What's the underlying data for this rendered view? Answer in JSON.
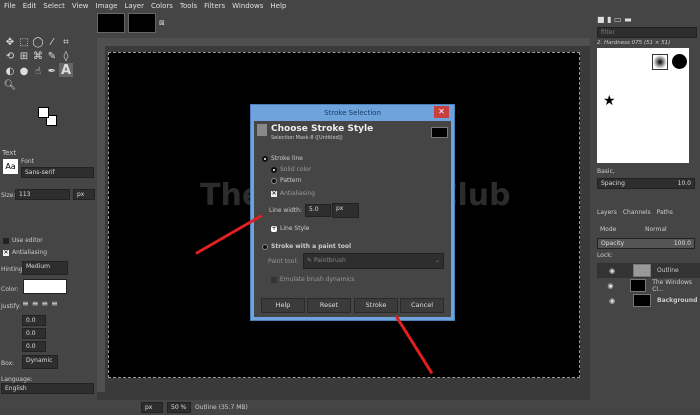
{
  "menu": [
    "File",
    "Edit",
    "Select",
    "View",
    "Image",
    "Layer",
    "Colors",
    "Tools",
    "Filters",
    "Windows",
    "Help"
  ],
  "toolbox": {
    "section_title": "Text",
    "font_label": "Font",
    "font_value": "Sans-serif",
    "size_label": "Size:",
    "size_value": "113",
    "size_unit": "px",
    "use_editor": "Use editor",
    "antialiasing": "Antialiasing",
    "hinting_label": "Hinting:",
    "hinting_value": "Medium",
    "color_label": "Color:",
    "color_value": "#ffffff",
    "justify_label": "Justify:",
    "indent": "0.0",
    "line_spacing": "0.0",
    "letter_spacing": "0.0",
    "box_label": "Box:",
    "box_value": "Dynamic",
    "language_label": "Language:",
    "language_value": "English"
  },
  "canvas": {
    "watermark": "The Windows Club"
  },
  "dialog": {
    "title": "Stroke Selection",
    "heading": "Choose Stroke Style",
    "subheading": "Selection Mask-8 ([Untitled])",
    "stroke_line": "Stroke line",
    "solid_color": "Solid color",
    "pattern": "Pattern",
    "antialiasing": "Antialiasing",
    "line_width_label": "Line width:",
    "line_width_value": "5.0",
    "line_width_unit": "px",
    "line_style": "Line Style",
    "stroke_paint_tool": "Stroke with a paint tool",
    "paint_tool_label": "Paint tool:",
    "paint_tool_value": "Paintbrush",
    "emulate": "Emulate brush dynamics",
    "buttons": {
      "help": "Help",
      "reset": "Reset",
      "stroke": "Stroke",
      "cancel": "Cancel"
    }
  },
  "brushes": {
    "filter_placeholder": "filter",
    "current": "2. Hardness 075 (51 × 51)",
    "tag": "Basic,",
    "spacing_label": "Spacing",
    "spacing_value": "10.0"
  },
  "layers": {
    "tabs": [
      "Layers",
      "Channels",
      "Paths"
    ],
    "mode_label": "Mode",
    "mode_value": "Normal",
    "opacity_label": "Opacity",
    "opacity_value": "100.0",
    "lock_label": "Lock:",
    "items": [
      {
        "name": "Outline"
      },
      {
        "name": "The Windows Cl..."
      },
      {
        "name": "Background"
      }
    ]
  },
  "status": {
    "unit": "px",
    "zoom": "50 %",
    "info": "Outline (35.7 MB)"
  },
  "colors": {
    "arrow": "#e02020",
    "dialog_frame": "#6fa3dc"
  }
}
